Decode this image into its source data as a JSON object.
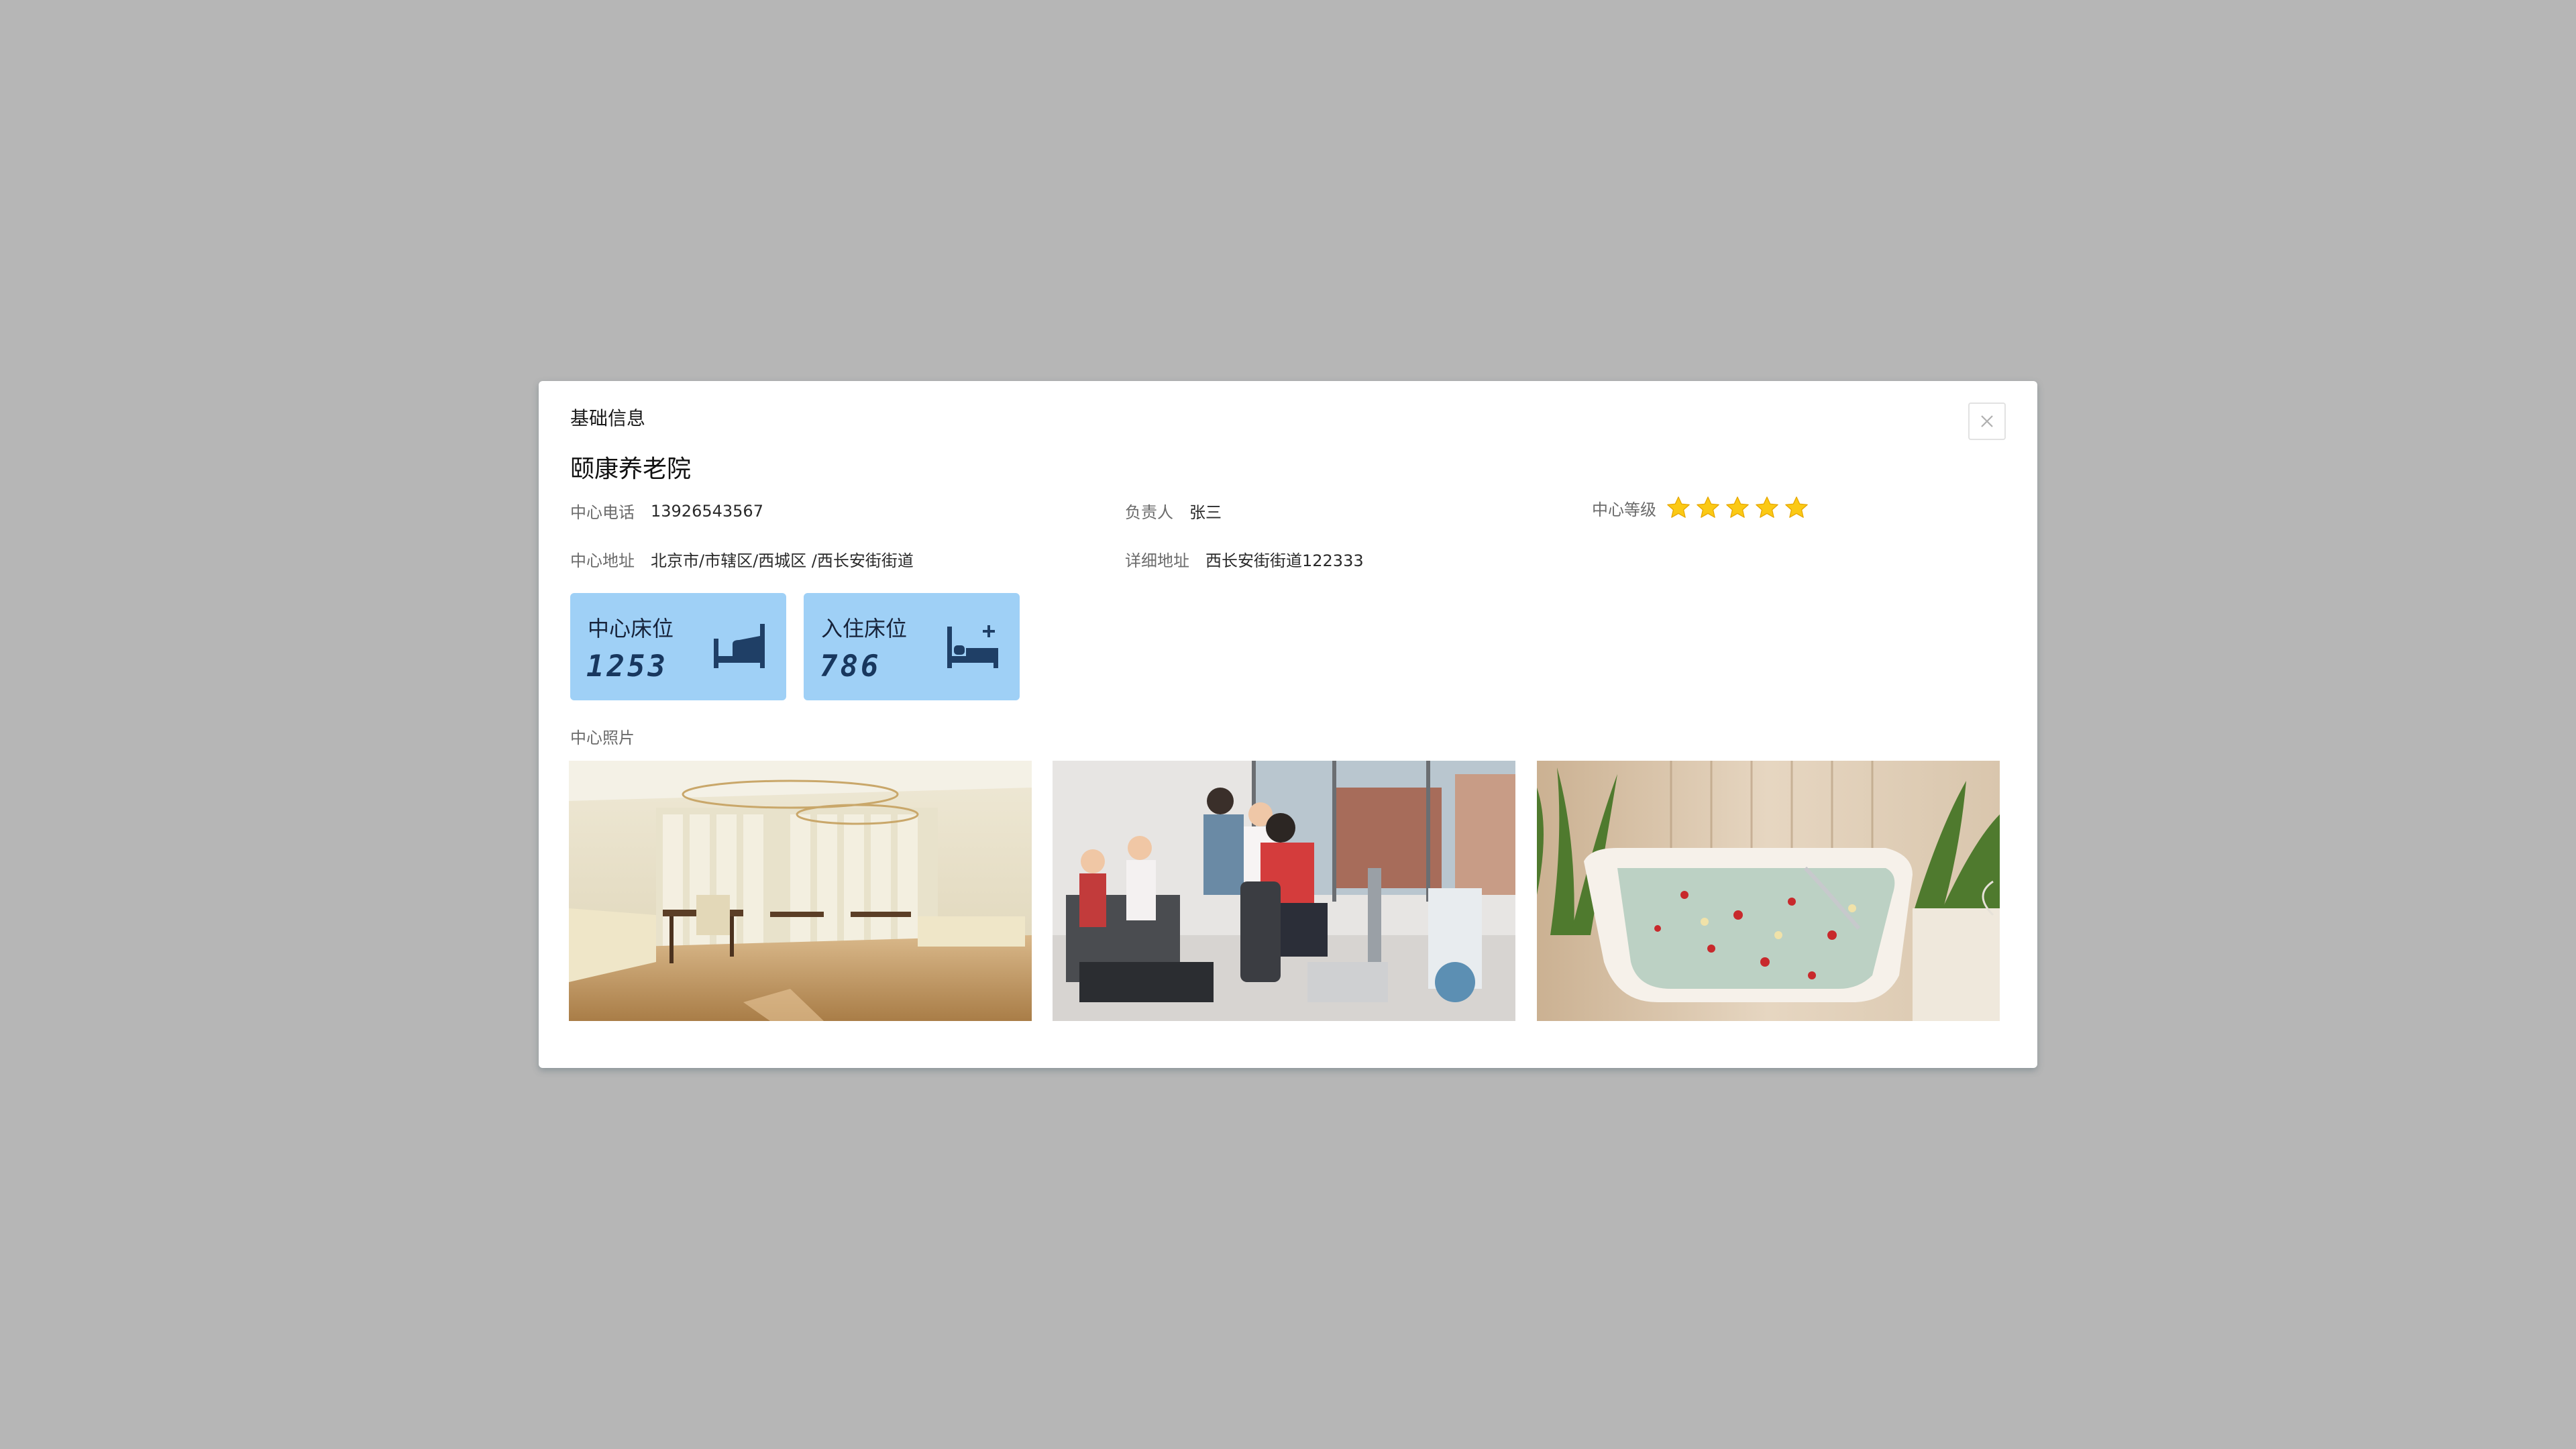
{
  "modal": {
    "title": "基础信息",
    "close_icon": "close-icon"
  },
  "center": {
    "name": "颐康养老院",
    "phone_label": "中心电话",
    "phone": "13926543567",
    "manager_label": "负责人",
    "manager": "张三",
    "level_label": "中心等级",
    "level_stars": 5,
    "address_label": "中心地址",
    "address": "北京市/市辖区/西城区 /西长安街街道",
    "detail_address_label": "详细地址",
    "detail_address": "西长安街街道122333"
  },
  "stats": {
    "center_beds_label": "中心床位",
    "center_beds": "1253",
    "center_beds_icon": "bed-icon",
    "occupied_beds_label": "入住床位",
    "occupied_beds": "786",
    "occupied_beds_icon": "bed-add-icon"
  },
  "photos": {
    "label": "中心照片",
    "items": [
      "dining-hall-photo",
      "rehab-gym-photo",
      "bathtub-photo"
    ]
  },
  "colors": {
    "overlay": "#b6b6b6",
    "card": "#9fd0f6",
    "card_value": "#18375e",
    "star": "#fbc915"
  }
}
